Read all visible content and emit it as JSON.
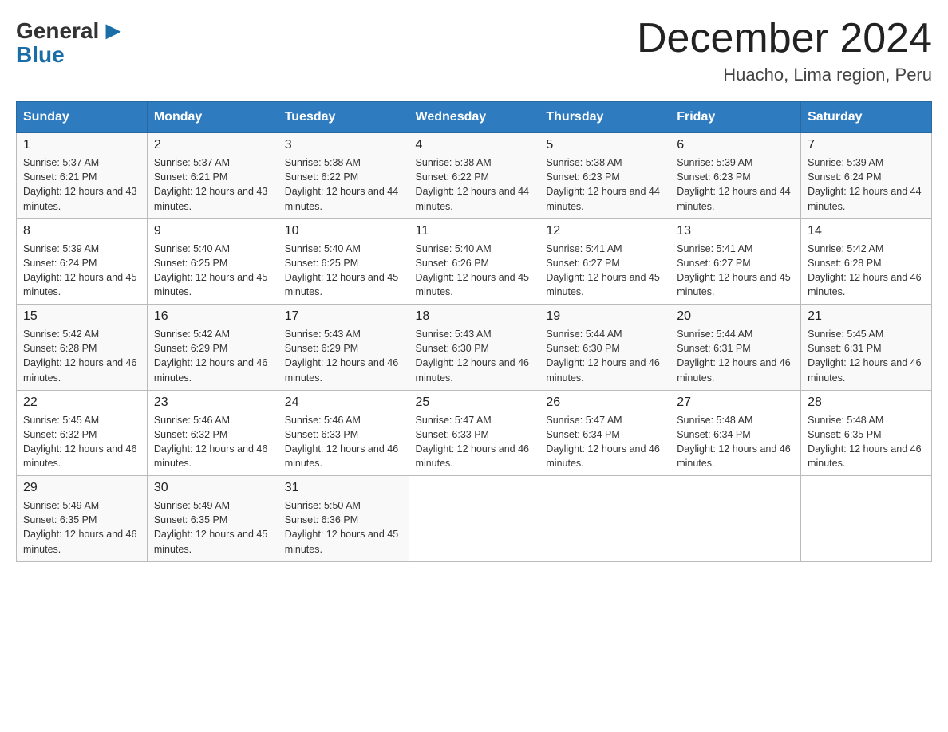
{
  "header": {
    "logo_general": "General",
    "logo_blue": "Blue",
    "main_title": "December 2024",
    "subtitle": "Huacho, Lima region, Peru"
  },
  "calendar": {
    "days_of_week": [
      "Sunday",
      "Monday",
      "Tuesday",
      "Wednesday",
      "Thursday",
      "Friday",
      "Saturday"
    ],
    "weeks": [
      [
        {
          "day": "1",
          "sunrise": "Sunrise: 5:37 AM",
          "sunset": "Sunset: 6:21 PM",
          "daylight": "Daylight: 12 hours and 43 minutes."
        },
        {
          "day": "2",
          "sunrise": "Sunrise: 5:37 AM",
          "sunset": "Sunset: 6:21 PM",
          "daylight": "Daylight: 12 hours and 43 minutes."
        },
        {
          "day": "3",
          "sunrise": "Sunrise: 5:38 AM",
          "sunset": "Sunset: 6:22 PM",
          "daylight": "Daylight: 12 hours and 44 minutes."
        },
        {
          "day": "4",
          "sunrise": "Sunrise: 5:38 AM",
          "sunset": "Sunset: 6:22 PM",
          "daylight": "Daylight: 12 hours and 44 minutes."
        },
        {
          "day": "5",
          "sunrise": "Sunrise: 5:38 AM",
          "sunset": "Sunset: 6:23 PM",
          "daylight": "Daylight: 12 hours and 44 minutes."
        },
        {
          "day": "6",
          "sunrise": "Sunrise: 5:39 AM",
          "sunset": "Sunset: 6:23 PM",
          "daylight": "Daylight: 12 hours and 44 minutes."
        },
        {
          "day": "7",
          "sunrise": "Sunrise: 5:39 AM",
          "sunset": "Sunset: 6:24 PM",
          "daylight": "Daylight: 12 hours and 44 minutes."
        }
      ],
      [
        {
          "day": "8",
          "sunrise": "Sunrise: 5:39 AM",
          "sunset": "Sunset: 6:24 PM",
          "daylight": "Daylight: 12 hours and 45 minutes."
        },
        {
          "day": "9",
          "sunrise": "Sunrise: 5:40 AM",
          "sunset": "Sunset: 6:25 PM",
          "daylight": "Daylight: 12 hours and 45 minutes."
        },
        {
          "day": "10",
          "sunrise": "Sunrise: 5:40 AM",
          "sunset": "Sunset: 6:25 PM",
          "daylight": "Daylight: 12 hours and 45 minutes."
        },
        {
          "day": "11",
          "sunrise": "Sunrise: 5:40 AM",
          "sunset": "Sunset: 6:26 PM",
          "daylight": "Daylight: 12 hours and 45 minutes."
        },
        {
          "day": "12",
          "sunrise": "Sunrise: 5:41 AM",
          "sunset": "Sunset: 6:27 PM",
          "daylight": "Daylight: 12 hours and 45 minutes."
        },
        {
          "day": "13",
          "sunrise": "Sunrise: 5:41 AM",
          "sunset": "Sunset: 6:27 PM",
          "daylight": "Daylight: 12 hours and 45 minutes."
        },
        {
          "day": "14",
          "sunrise": "Sunrise: 5:42 AM",
          "sunset": "Sunset: 6:28 PM",
          "daylight": "Daylight: 12 hours and 46 minutes."
        }
      ],
      [
        {
          "day": "15",
          "sunrise": "Sunrise: 5:42 AM",
          "sunset": "Sunset: 6:28 PM",
          "daylight": "Daylight: 12 hours and 46 minutes."
        },
        {
          "day": "16",
          "sunrise": "Sunrise: 5:42 AM",
          "sunset": "Sunset: 6:29 PM",
          "daylight": "Daylight: 12 hours and 46 minutes."
        },
        {
          "day": "17",
          "sunrise": "Sunrise: 5:43 AM",
          "sunset": "Sunset: 6:29 PM",
          "daylight": "Daylight: 12 hours and 46 minutes."
        },
        {
          "day": "18",
          "sunrise": "Sunrise: 5:43 AM",
          "sunset": "Sunset: 6:30 PM",
          "daylight": "Daylight: 12 hours and 46 minutes."
        },
        {
          "day": "19",
          "sunrise": "Sunrise: 5:44 AM",
          "sunset": "Sunset: 6:30 PM",
          "daylight": "Daylight: 12 hours and 46 minutes."
        },
        {
          "day": "20",
          "sunrise": "Sunrise: 5:44 AM",
          "sunset": "Sunset: 6:31 PM",
          "daylight": "Daylight: 12 hours and 46 minutes."
        },
        {
          "day": "21",
          "sunrise": "Sunrise: 5:45 AM",
          "sunset": "Sunset: 6:31 PM",
          "daylight": "Daylight: 12 hours and 46 minutes."
        }
      ],
      [
        {
          "day": "22",
          "sunrise": "Sunrise: 5:45 AM",
          "sunset": "Sunset: 6:32 PM",
          "daylight": "Daylight: 12 hours and 46 minutes."
        },
        {
          "day": "23",
          "sunrise": "Sunrise: 5:46 AM",
          "sunset": "Sunset: 6:32 PM",
          "daylight": "Daylight: 12 hours and 46 minutes."
        },
        {
          "day": "24",
          "sunrise": "Sunrise: 5:46 AM",
          "sunset": "Sunset: 6:33 PM",
          "daylight": "Daylight: 12 hours and 46 minutes."
        },
        {
          "day": "25",
          "sunrise": "Sunrise: 5:47 AM",
          "sunset": "Sunset: 6:33 PM",
          "daylight": "Daylight: 12 hours and 46 minutes."
        },
        {
          "day": "26",
          "sunrise": "Sunrise: 5:47 AM",
          "sunset": "Sunset: 6:34 PM",
          "daylight": "Daylight: 12 hours and 46 minutes."
        },
        {
          "day": "27",
          "sunrise": "Sunrise: 5:48 AM",
          "sunset": "Sunset: 6:34 PM",
          "daylight": "Daylight: 12 hours and 46 minutes."
        },
        {
          "day": "28",
          "sunrise": "Sunrise: 5:48 AM",
          "sunset": "Sunset: 6:35 PM",
          "daylight": "Daylight: 12 hours and 46 minutes."
        }
      ],
      [
        {
          "day": "29",
          "sunrise": "Sunrise: 5:49 AM",
          "sunset": "Sunset: 6:35 PM",
          "daylight": "Daylight: 12 hours and 46 minutes."
        },
        {
          "day": "30",
          "sunrise": "Sunrise: 5:49 AM",
          "sunset": "Sunset: 6:35 PM",
          "daylight": "Daylight: 12 hours and 45 minutes."
        },
        {
          "day": "31",
          "sunrise": "Sunrise: 5:50 AM",
          "sunset": "Sunset: 6:36 PM",
          "daylight": "Daylight: 12 hours and 45 minutes."
        },
        null,
        null,
        null,
        null
      ]
    ]
  }
}
